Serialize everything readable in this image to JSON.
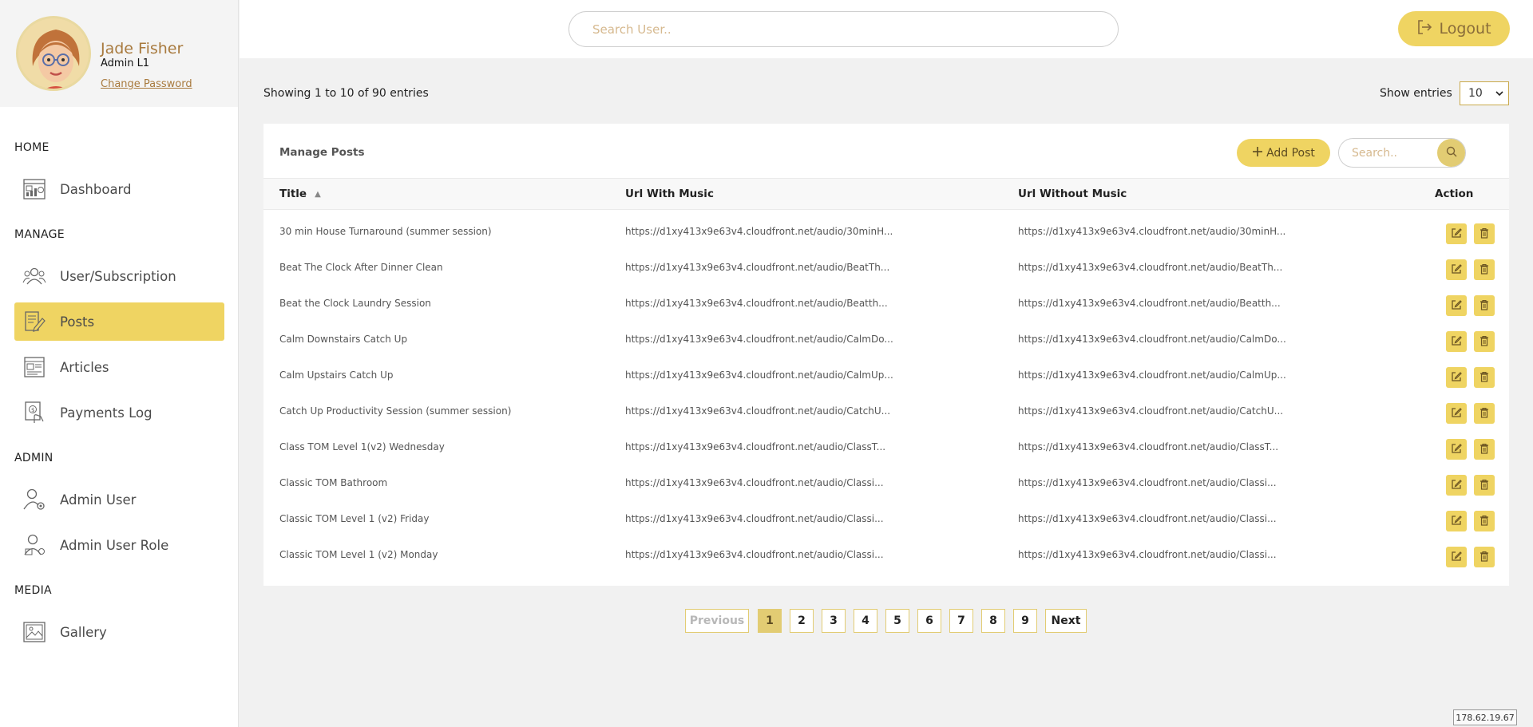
{
  "profile": {
    "name": "Jade Fisher",
    "role": "Admin L1",
    "change_password": "Change Password"
  },
  "sidebar": {
    "sections": [
      {
        "title": "HOME"
      },
      {
        "title": "MANAGE"
      },
      {
        "title": "ADMIN"
      },
      {
        "title": "MEDIA"
      }
    ],
    "items": [
      {
        "label": "Dashboard",
        "icon": "dashboard-icon"
      },
      {
        "label": "User/Subscription",
        "icon": "users-icon"
      },
      {
        "label": "Posts",
        "icon": "posts-icon",
        "active": true
      },
      {
        "label": "Articles",
        "icon": "articles-icon"
      },
      {
        "label": "Payments Log",
        "icon": "payments-icon"
      },
      {
        "label": "Admin User",
        "icon": "admin-user-icon"
      },
      {
        "label": "Admin User Role",
        "icon": "admin-role-icon"
      },
      {
        "label": "Gallery",
        "icon": "gallery-icon"
      }
    ]
  },
  "topbar": {
    "search_placeholder": "Search User..",
    "logout_label": "Logout"
  },
  "entries": {
    "info": "Showing 1 to 10 of 90 entries",
    "show_label": "Show entries",
    "page_size": "10"
  },
  "panel": {
    "title": "Manage Posts",
    "add_label": "Add Post",
    "search_placeholder": "Search.."
  },
  "table": {
    "headers": {
      "title": "Title",
      "with_music": "Url With Music",
      "without_music": "Url Without Music",
      "action": "Action"
    },
    "rows": [
      {
        "title": "30 min House Turnaround (summer session)",
        "with_music": "https://d1xy413x9e63v4.cloudfront.net/audio/30minH...",
        "without_music": "https://d1xy413x9e63v4.cloudfront.net/audio/30minH..."
      },
      {
        "title": "Beat The Clock After Dinner Clean",
        "with_music": "https://d1xy413x9e63v4.cloudfront.net/audio/BeatTh...",
        "without_music": "https://d1xy413x9e63v4.cloudfront.net/audio/BeatTh..."
      },
      {
        "title": "Beat the Clock Laundry Session",
        "with_music": "https://d1xy413x9e63v4.cloudfront.net/audio/Beatth...",
        "without_music": "https://d1xy413x9e63v4.cloudfront.net/audio/Beatth..."
      },
      {
        "title": "Calm Downstairs Catch Up",
        "with_music": "https://d1xy413x9e63v4.cloudfront.net/audio/CalmDo...",
        "without_music": "https://d1xy413x9e63v4.cloudfront.net/audio/CalmDo..."
      },
      {
        "title": "Calm Upstairs Catch Up",
        "with_music": "https://d1xy413x9e63v4.cloudfront.net/audio/CalmUp...",
        "without_music": "https://d1xy413x9e63v4.cloudfront.net/audio/CalmUp..."
      },
      {
        "title": "Catch Up Productivity Session (summer session)",
        "with_music": "https://d1xy413x9e63v4.cloudfront.net/audio/CatchU...",
        "without_music": "https://d1xy413x9e63v4.cloudfront.net/audio/CatchU..."
      },
      {
        "title": "Class TOM Level 1(v2) Wednesday",
        "with_music": "https://d1xy413x9e63v4.cloudfront.net/audio/ClassT...",
        "without_music": "https://d1xy413x9e63v4.cloudfront.net/audio/ClassT..."
      },
      {
        "title": "Classic TOM Bathroom",
        "with_music": "https://d1xy413x9e63v4.cloudfront.net/audio/Classi...",
        "without_music": "https://d1xy413x9e63v4.cloudfront.net/audio/Classi..."
      },
      {
        "title": "Classic TOM Level 1 (v2) Friday",
        "with_music": "https://d1xy413x9e63v4.cloudfront.net/audio/Classi...",
        "without_music": "https://d1xy413x9e63v4.cloudfront.net/audio/Classi..."
      },
      {
        "title": "Classic TOM Level 1 (v2) Monday",
        "with_music": "https://d1xy413x9e63v4.cloudfront.net/audio/Classi...",
        "without_music": "https://d1xy413x9e63v4.cloudfront.net/audio/Classi..."
      }
    ]
  },
  "pagination": {
    "previous": "Previous",
    "next": "Next",
    "pages": [
      "1",
      "2",
      "3",
      "4",
      "5",
      "6",
      "7",
      "8",
      "9"
    ],
    "current": "1"
  },
  "ip_address": "178.62.19.67",
  "colors": {
    "accent": "#efd462",
    "accent_dark": "#e2cc73",
    "brand_text": "#a87a3e"
  }
}
